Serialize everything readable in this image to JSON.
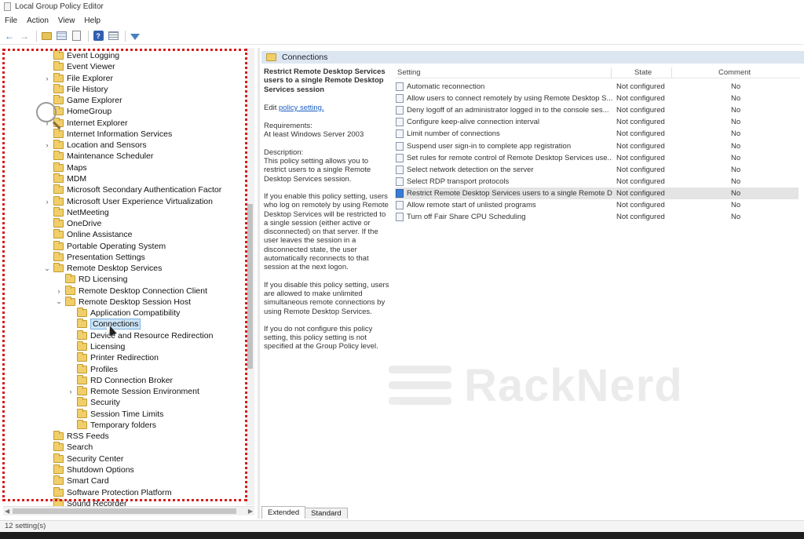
{
  "window": {
    "title": "Local Group Policy Editor"
  },
  "menu": [
    "File",
    "Action",
    "View",
    "Help"
  ],
  "tree": [
    {
      "label": "Event Logging",
      "indent": 0,
      "expander": ""
    },
    {
      "label": "Event Viewer",
      "indent": 0,
      "expander": ""
    },
    {
      "label": "File Explorer",
      "indent": 0,
      "expander": ">"
    },
    {
      "label": "File History",
      "indent": 0,
      "expander": ""
    },
    {
      "label": "Game Explorer",
      "indent": 0,
      "expander": ""
    },
    {
      "label": "HomeGroup",
      "indent": 0,
      "expander": ""
    },
    {
      "label": "Internet Explorer",
      "indent": 0,
      "expander": ">"
    },
    {
      "label": "Internet Information Services",
      "indent": 0,
      "expander": ""
    },
    {
      "label": "Location and Sensors",
      "indent": 0,
      "expander": ">"
    },
    {
      "label": "Maintenance Scheduler",
      "indent": 0,
      "expander": ""
    },
    {
      "label": "Maps",
      "indent": 0,
      "expander": ""
    },
    {
      "label": "MDM",
      "indent": 0,
      "expander": ""
    },
    {
      "label": "Microsoft Secondary Authentication Factor",
      "indent": 0,
      "expander": ""
    },
    {
      "label": "Microsoft User Experience Virtualization",
      "indent": 0,
      "expander": ">"
    },
    {
      "label": "NetMeeting",
      "indent": 0,
      "expander": ""
    },
    {
      "label": "OneDrive",
      "indent": 0,
      "expander": ""
    },
    {
      "label": "Online Assistance",
      "indent": 0,
      "expander": ""
    },
    {
      "label": "Portable Operating System",
      "indent": 0,
      "expander": ""
    },
    {
      "label": "Presentation Settings",
      "indent": 0,
      "expander": ""
    },
    {
      "label": "Remote Desktop Services",
      "indent": 0,
      "expander": "v"
    },
    {
      "label": "RD Licensing",
      "indent": 1,
      "expander": ""
    },
    {
      "label": "Remote Desktop Connection Client",
      "indent": 1,
      "expander": ">"
    },
    {
      "label": "Remote Desktop Session Host",
      "indent": 1,
      "expander": "v"
    },
    {
      "label": "Application Compatibility",
      "indent": 2,
      "expander": ""
    },
    {
      "label": "Connections",
      "indent": 2,
      "expander": "",
      "selected": true
    },
    {
      "label": "Device and Resource Redirection",
      "indent": 2,
      "expander": ""
    },
    {
      "label": "Licensing",
      "indent": 2,
      "expander": ""
    },
    {
      "label": "Printer Redirection",
      "indent": 2,
      "expander": ""
    },
    {
      "label": "Profiles",
      "indent": 2,
      "expander": ""
    },
    {
      "label": "RD Connection Broker",
      "indent": 2,
      "expander": ""
    },
    {
      "label": "Remote Session Environment",
      "indent": 2,
      "expander": ">"
    },
    {
      "label": "Security",
      "indent": 2,
      "expander": ""
    },
    {
      "label": "Session Time Limits",
      "indent": 2,
      "expander": ""
    },
    {
      "label": "Temporary folders",
      "indent": 2,
      "expander": ""
    },
    {
      "label": "RSS Feeds",
      "indent": 0,
      "expander": ""
    },
    {
      "label": "Search",
      "indent": 0,
      "expander": ""
    },
    {
      "label": "Security Center",
      "indent": 0,
      "expander": ""
    },
    {
      "label": "Shutdown Options",
      "indent": 0,
      "expander": ""
    },
    {
      "label": "Smart Card",
      "indent": 0,
      "expander": ""
    },
    {
      "label": "Software Protection Platform",
      "indent": 0,
      "expander": ""
    },
    {
      "label": "Sound Recorder",
      "indent": 0,
      "expander": ""
    }
  ],
  "right": {
    "header": "Connections",
    "description": {
      "title": "Restrict Remote Desktop Services users to a single Remote Desktop Services session",
      "edit_prefix": "Edit",
      "edit_link": "policy setting.",
      "requirements_label": "Requirements:",
      "requirements": "At least Windows Server 2003",
      "description_label": "Description:",
      "p1": "This policy setting allows you to restrict users to a single Remote Desktop Services session.",
      "p2": "If you enable this policy setting, users who log on remotely by using Remote Desktop Services will be restricted to a single session (either active or disconnected) on that server. If the user leaves the session in a disconnected state, the user automatically reconnects to that session at the next logon.",
      "p3": "If you disable this policy setting, users are allowed to make unlimited simultaneous remote connections by using Remote Desktop Services.",
      "p4": "If you do not configure this policy setting, this policy setting is not specified at the Group Policy level."
    },
    "columns": {
      "setting": "Setting",
      "state": "State",
      "comment": "Comment"
    },
    "rows": [
      {
        "setting": "Automatic reconnection",
        "state": "Not configured",
        "comment": "No"
      },
      {
        "setting": "Allow users to connect remotely by using Remote Desktop S...",
        "state": "Not configured",
        "comment": "No"
      },
      {
        "setting": "Deny logoff of an administrator logged in to the console ses...",
        "state": "Not configured",
        "comment": "No"
      },
      {
        "setting": "Configure keep-alive connection interval",
        "state": "Not configured",
        "comment": "No"
      },
      {
        "setting": "Limit number of connections",
        "state": "Not configured",
        "comment": "No"
      },
      {
        "setting": "Suspend user sign-in to complete app registration",
        "state": "Not configured",
        "comment": "No"
      },
      {
        "setting": "Set rules for remote control of Remote Desktop Services use...",
        "state": "Not configured",
        "comment": "No"
      },
      {
        "setting": "Select network detection on the server",
        "state": "Not configured",
        "comment": "No"
      },
      {
        "setting": "Select RDP transport protocols",
        "state": "Not configured",
        "comment": "No"
      },
      {
        "setting": "Restrict Remote Desktop Services users to a single Remote D...",
        "state": "Not configured",
        "comment": "No",
        "selected": true
      },
      {
        "setting": "Allow remote start of unlisted programs",
        "state": "Not configured",
        "comment": "No"
      },
      {
        "setting": "Turn off Fair Share CPU Scheduling",
        "state": "Not configured",
        "comment": "No"
      }
    ]
  },
  "tabs": [
    "Extended",
    "Standard"
  ],
  "status": "12 setting(s)",
  "watermark": "RackNerd"
}
